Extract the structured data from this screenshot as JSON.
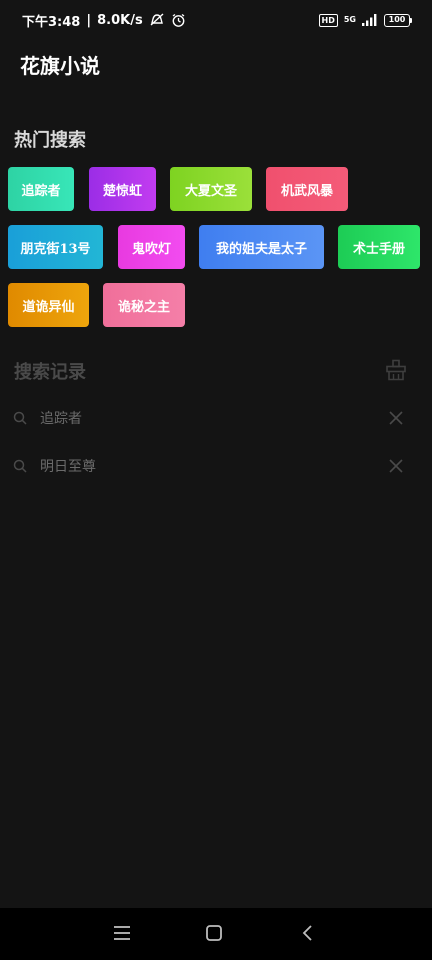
{
  "status_bar": {
    "time": "下午3:48",
    "separator": "|",
    "speed": "8.0K/s",
    "hd": "HD",
    "network": "5G",
    "battery": "100"
  },
  "app": {
    "title": "花旗小说"
  },
  "hot_search": {
    "title": "热门搜索",
    "tags": [
      {
        "label": "追踪者",
        "color_from": "#2ed3a4",
        "color_to": "#38e6b8"
      },
      {
        "label": "楚惊虹",
        "color_from": "#9b2de6",
        "color_to": "#c23cf0"
      },
      {
        "label": "大夏文圣",
        "color_from": "#7ed321",
        "color_to": "#9be03a"
      },
      {
        "label": "机武风暴",
        "color_from": "#f0506e",
        "color_to": "#f45b78"
      },
      {
        "label": "朋克街13号",
        "color_from": "#1a9fd8",
        "color_to": "#22b6d6"
      },
      {
        "label": "鬼吹灯",
        "color_from": "#e83ae0",
        "color_to": "#f24cf0"
      },
      {
        "label": "我的姐夫是太子",
        "color_from": "#3f7ef0",
        "color_to": "#5b95f5"
      },
      {
        "label": "术士手册",
        "color_from": "#1dcc55",
        "color_to": "#2ee66a"
      },
      {
        "label": "道诡异仙",
        "color_from": "#e08a00",
        "color_to": "#eea50c"
      },
      {
        "label": "诡秘之主",
        "color_from": "#f06f9a",
        "color_to": "#f57fa8"
      }
    ]
  },
  "history": {
    "title": "搜索记录",
    "items": [
      "追踪者",
      "明日至尊"
    ]
  },
  "icons": {
    "clear": "trash-icon",
    "search": "search-icon",
    "delete": "close-icon"
  }
}
